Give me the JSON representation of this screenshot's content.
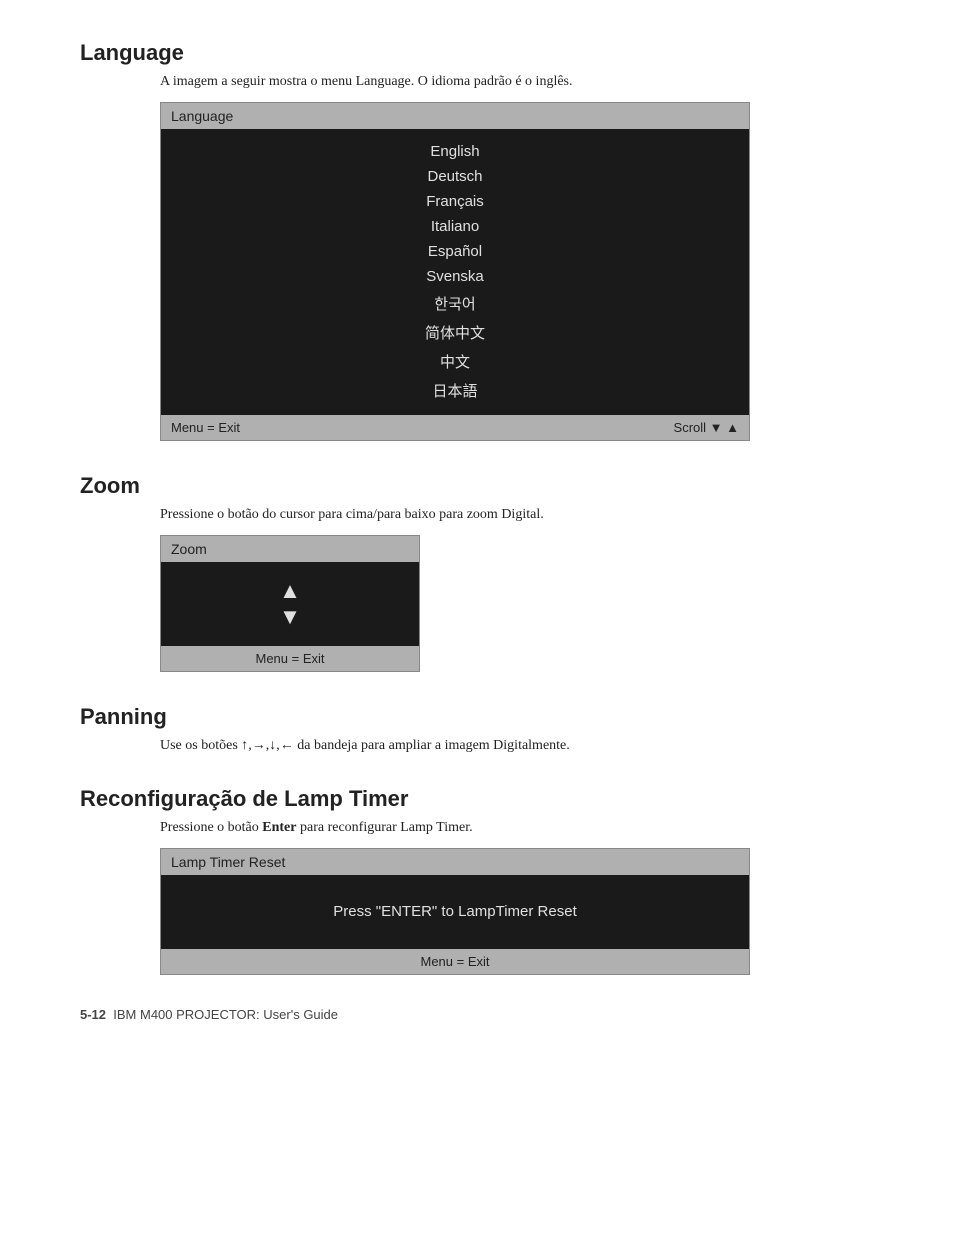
{
  "language_section": {
    "title": "Language",
    "description": "A imagem a seguir mostra o menu Language. O idioma padrão é o inglês.",
    "menu": {
      "header": "Language",
      "items": [
        "English",
        "Deutsch",
        "Français",
        "Italiano",
        "Español",
        "Svenska",
        "한국어",
        "简体中文",
        "中文",
        "日本語"
      ],
      "footer_left": "Menu = Exit",
      "footer_right": "Scroll ▼ ▲"
    }
  },
  "zoom_section": {
    "title": "Zoom",
    "description": "Pressione o botão do cursor para cima/para baixo para zoom Digital.",
    "menu": {
      "header": "Zoom",
      "arrow_up": "▲",
      "arrow_down": "▼",
      "footer": "Menu = Exit"
    }
  },
  "panning_section": {
    "title": "Panning",
    "description": "Use os botões ↑,→,↓,← da bandeja para ampliar a imagem Digitalmente."
  },
  "lamp_section": {
    "title": "Reconfiguração de Lamp Timer",
    "description_before": "Pressione o botão ",
    "description_bold": "Enter",
    "description_after": " para reconfigurar Lamp Timer.",
    "menu": {
      "header": "Lamp Timer Reset",
      "body_text": "Press \"ENTER\" to LampTimer Reset",
      "footer": "Menu = Exit"
    }
  },
  "page_footer": {
    "page_num": "5-12",
    "text": "IBM M400 PROJECTOR: User's Guide"
  }
}
